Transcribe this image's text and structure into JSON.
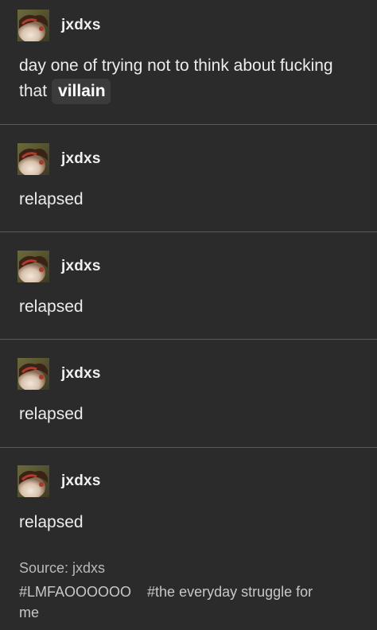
{
  "posts": [
    {
      "username": "jxdxs",
      "text": "day one of trying not to think about fucking that",
      "highlight": "villain"
    },
    {
      "username": "jxdxs",
      "text": "relapsed"
    },
    {
      "username": "jxdxs",
      "text": "relapsed"
    },
    {
      "username": "jxdxs",
      "text": "relapsed"
    },
    {
      "username": "jxdxs",
      "text": "relapsed"
    }
  ],
  "source": "Source: jxdxs",
  "tags": [
    "#LMFAOOOOOO",
    "#the everyday struggle for me"
  ],
  "colors": {
    "background": "#2b2b2b",
    "divider": "#5a5a5a",
    "text": "#ececec",
    "highlight_bg": "#3b3b3b"
  }
}
